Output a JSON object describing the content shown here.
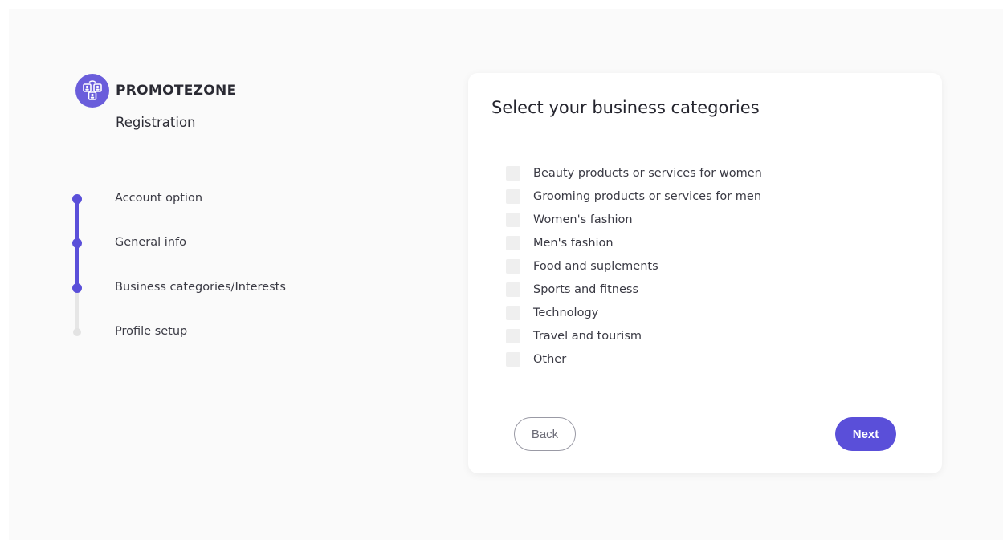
{
  "brand": {
    "name": "PROMOTEZONE",
    "logo_icon": "people-network-icon"
  },
  "page": {
    "subtitle": "Registration"
  },
  "steps": [
    {
      "label": "Account option",
      "status": "completed"
    },
    {
      "label": "General info",
      "status": "completed"
    },
    {
      "label": "Business categories/Interests",
      "status": "current"
    },
    {
      "label": "Profile setup",
      "status": "pending"
    }
  ],
  "card": {
    "title": "Select your business categories",
    "options": [
      {
        "label": "Beauty products or services for women",
        "checked": false
      },
      {
        "label": "Grooming products or services for men",
        "checked": false
      },
      {
        "label": "Women's fashion",
        "checked": false
      },
      {
        "label": "Men's fashion",
        "checked": false
      },
      {
        "label": "Food and suplements",
        "checked": false
      },
      {
        "label": "Sports and fitness",
        "checked": false
      },
      {
        "label": "Technology",
        "checked": false
      },
      {
        "label": "Travel and tourism",
        "checked": false
      },
      {
        "label": "Other",
        "checked": false
      }
    ],
    "back_label": "Back",
    "next_label": "Next"
  },
  "colors": {
    "accent": "#5a4fd9",
    "pending": "#e3e3e3",
    "text": "#3a3a44"
  }
}
